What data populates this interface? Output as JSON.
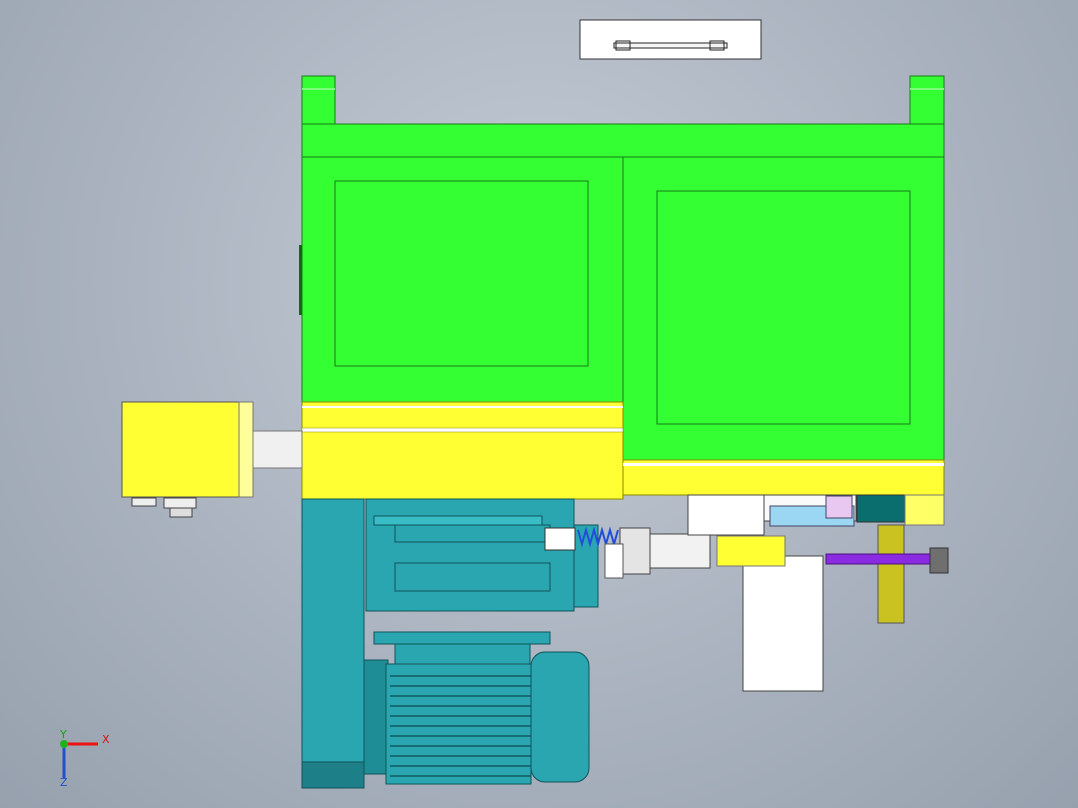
{
  "triad": {
    "x_label": "X",
    "y_label": "Y",
    "z_label": "Z"
  },
  "colors": {
    "frame_green": "#33ff33",
    "yellow": "#ffff33",
    "teal": "#2aa6b0",
    "purple": "#8a2be2",
    "background": "#aab3bf"
  }
}
